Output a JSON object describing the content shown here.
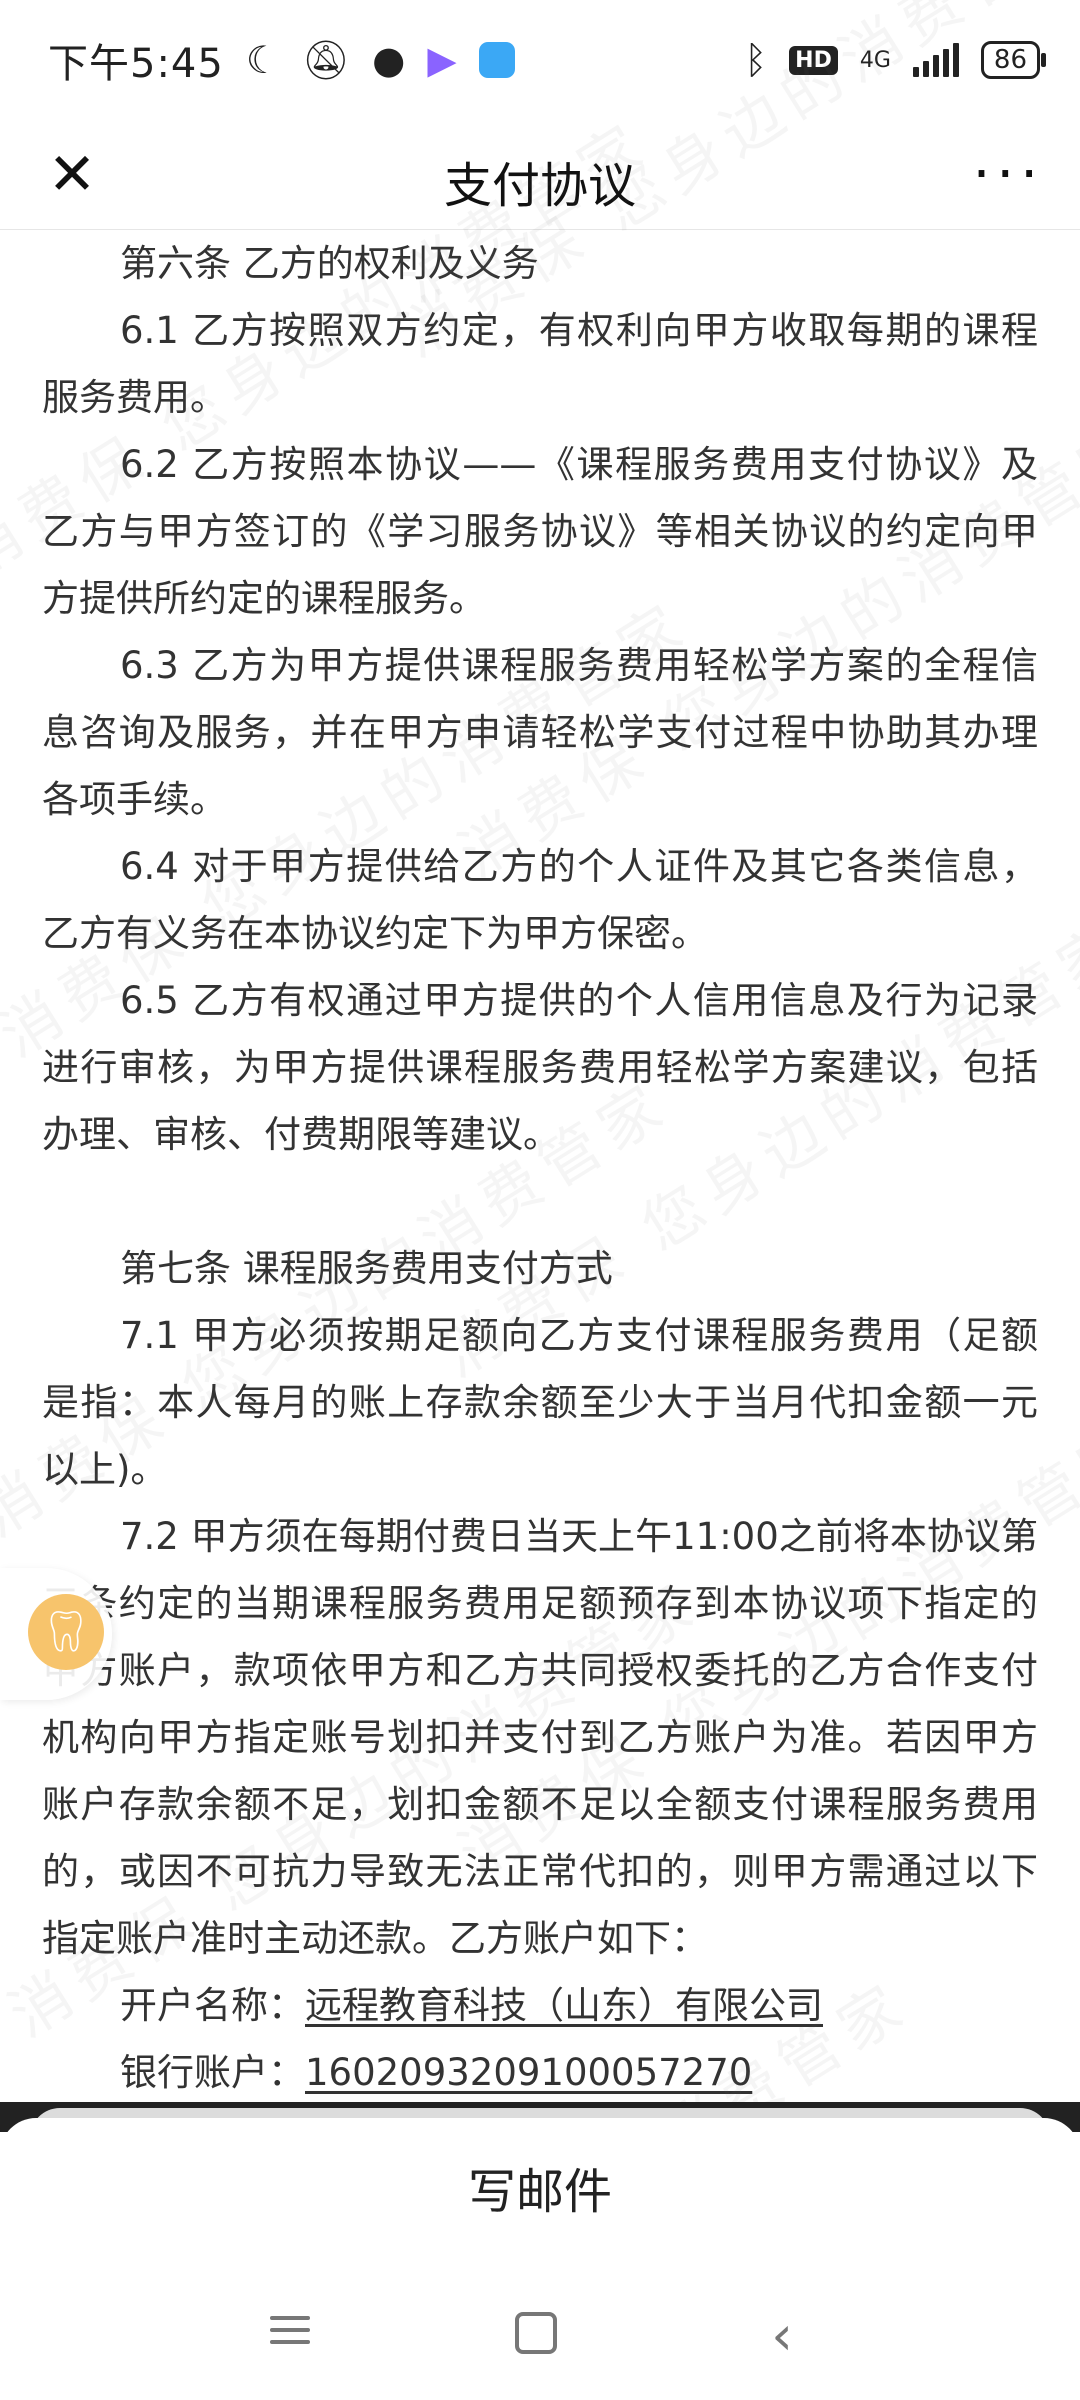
{
  "status_bar": {
    "time": "下午5:45",
    "network": "4G",
    "battery": "86",
    "hd_label": "HD"
  },
  "nav": {
    "title": "支付协议"
  },
  "watermark": {
    "text": "消费保 您身边的消费管家"
  },
  "content": {
    "art6_title": "第六条 乙方的权利及义务",
    "p6_1": "6.1 乙方按照双方约定，有权利向甲方收取每期的课程服务费用。",
    "p6_2": "6.2 乙方按照本协议——《课程服务费用支付协议》及乙方与甲方签订的《学习服务协议》等相关协议的约定向甲方提供所约定的课程服务。",
    "p6_3": "6.3 乙方为甲方提供课程服务费用轻松学方案的全程信息咨询及服务，并在甲方申请轻松学支付过程中协助其办理各项手续。",
    "p6_4": "6.4 对于甲方提供给乙方的个人证件及其它各类信息，乙方有义务在本协议约定下为甲方保密。",
    "p6_5": "6.5 乙方有权通过甲方提供的个人信用信息及行为记录进行审核，为甲方提供课程服务费用轻松学方案建议，包括办理、审核、付费期限等建议。",
    "art7_title": "第七条 课程服务费用支付方式",
    "p7_1": "7.1 甲方必须按期足额向乙方支付课程服务费用（足额是指：本人每月的账上存款余额至少大于当月代扣金额一元以上)。",
    "p7_2": "7.2 甲方须在每期付费日当天上午11:00之前将本协议第三条约定的当期课程服务费用足额预存到本协议项下指定的甲方账户，款项依甲方和乙方共同授权委托的乙方合作支付机构向甲方指定账号划扣并支付到乙方账户为准。若因甲方账户存款余额不足，划扣金额不足以全额支付课程服务费用的，或因不可抗力导致无法正常代扣的，则甲方需通过以下指定账户准时主动还款。乙方账户如下：",
    "account_name_label": "开户名称：",
    "account_name": "远程教育科技（山东）有限公司",
    "bank_account_label": "银行账户：",
    "bank_account": "1602093209100057270"
  },
  "bottom_sheet": {
    "compose_label": "写邮件"
  }
}
